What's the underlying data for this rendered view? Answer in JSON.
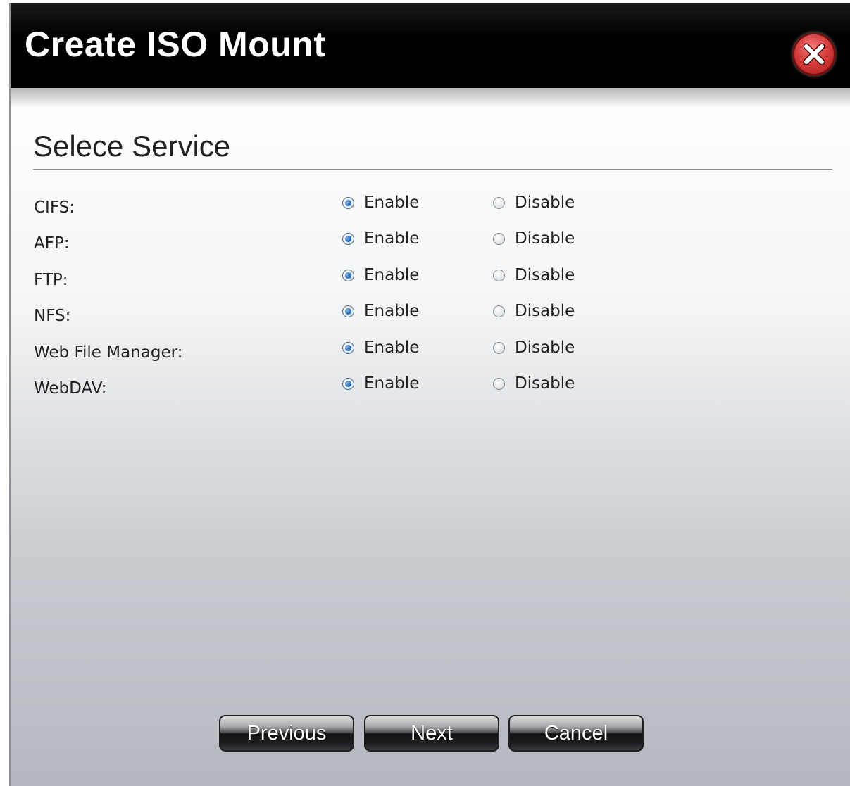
{
  "dialog": {
    "title": "Create ISO Mount",
    "close_icon": "close-icon"
  },
  "section": {
    "title": "Selece Service"
  },
  "services": [
    {
      "label": "CIFS:",
      "enable_label": "Enable",
      "disable_label": "Disable",
      "selected": "enable"
    },
    {
      "label": "AFP:",
      "enable_label": "Enable",
      "disable_label": "Disable",
      "selected": "enable"
    },
    {
      "label": "FTP:",
      "enable_label": "Enable",
      "disable_label": "Disable",
      "selected": "enable"
    },
    {
      "label": "NFS:",
      "enable_label": "Enable",
      "disable_label": "Disable",
      "selected": "enable"
    },
    {
      "label": "Web File Manager:",
      "enable_label": "Enable",
      "disable_label": "Disable",
      "selected": "enable"
    },
    {
      "label": "WebDAV:",
      "enable_label": "Enable",
      "disable_label": "Disable",
      "selected": "enable"
    }
  ],
  "buttons": {
    "previous": "Previous",
    "next": "Next",
    "cancel": "Cancel"
  },
  "colors": {
    "titlebar": "#000000",
    "close_button": "#d43b3b",
    "radio_selected": "#2e6fb8"
  }
}
